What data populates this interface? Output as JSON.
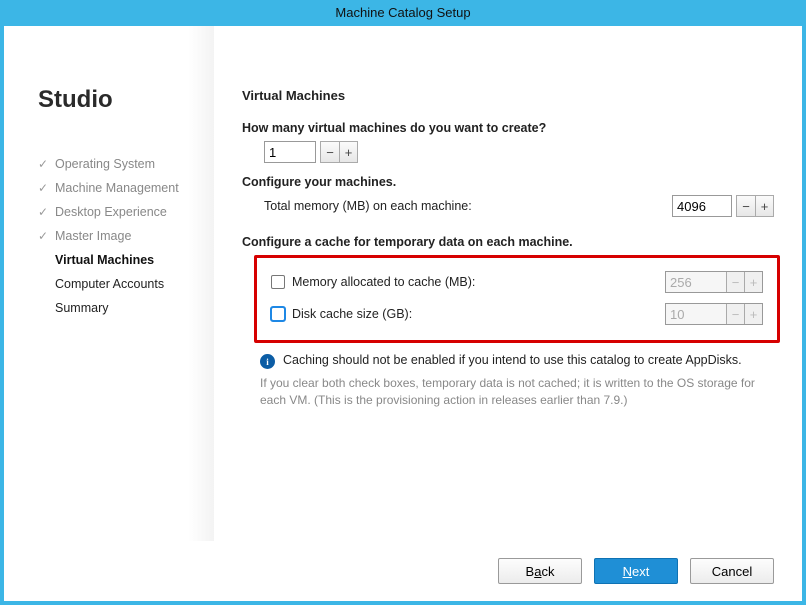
{
  "window": {
    "title": "Machine Catalog Setup"
  },
  "sidebar": {
    "brand": "Studio",
    "steps": [
      {
        "label": "Operating System",
        "state": "done"
      },
      {
        "label": "Machine Management",
        "state": "done"
      },
      {
        "label": "Desktop Experience",
        "state": "done"
      },
      {
        "label": "Master Image",
        "state": "done"
      },
      {
        "label": "Virtual Machines",
        "state": "current"
      },
      {
        "label": "Computer Accounts",
        "state": "pending"
      },
      {
        "label": "Summary",
        "state": "pending"
      }
    ]
  },
  "main": {
    "heading": "Virtual Machines",
    "q_count": "How many virtual machines do you want to create?",
    "vm_count": "1",
    "configure_label": "Configure your machines.",
    "memory_label": "Total memory (MB) on each machine:",
    "memory_value": "4096",
    "cache_heading": "Configure a cache for temporary data on each machine.",
    "cache_mem_label": "Memory allocated to cache (MB):",
    "cache_mem_value": "256",
    "cache_disk_label": "Disk cache size (GB):",
    "cache_disk_value": "10",
    "info_text": "Caching should not be enabled if you intend to use this catalog to create AppDisks.",
    "hint_text": "If you clear both check boxes, temporary data is not cached; it is written to the OS storage for each VM. (This is the provisioning action in releases earlier than 7.9.)"
  },
  "footer": {
    "back_pre": "B",
    "back_accel": "a",
    "back_post": "ck",
    "next_pre": "",
    "next_accel": "N",
    "next_post": "ext",
    "cancel": "Cancel"
  }
}
